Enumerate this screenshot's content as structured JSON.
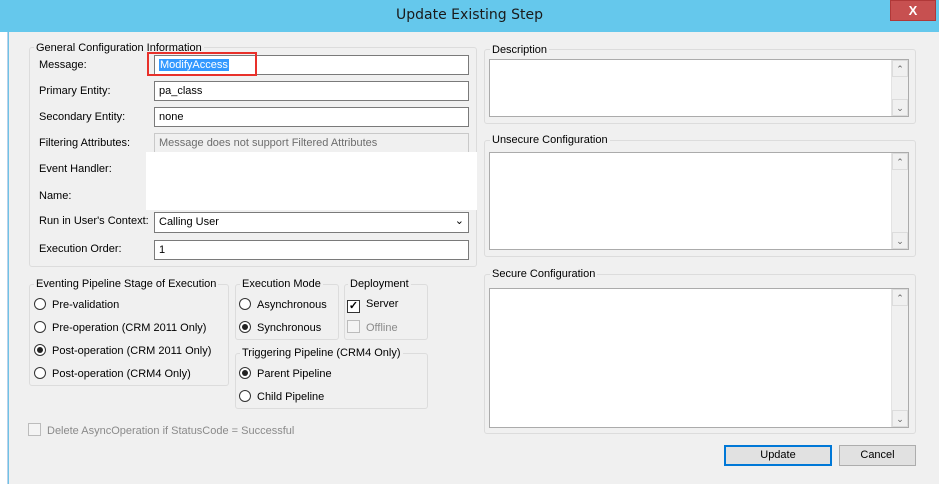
{
  "window": {
    "title": "Update Existing Step",
    "close_label": "X"
  },
  "general": {
    "group_title": "General Configuration Information",
    "message_label": "Message:",
    "message_value": "ModifyAccess",
    "primary_entity_label": "Primary Entity:",
    "primary_entity_value": "pa_class",
    "secondary_entity_label": "Secondary Entity:",
    "secondary_entity_value": "none",
    "filtering_label": "Filtering Attributes:",
    "filtering_value": "Message does not support Filtered Attributes",
    "event_handler_label": "Event Handler:",
    "name_label": "Name:",
    "run_context_label": "Run in User's Context:",
    "run_context_value": "Calling User",
    "execution_order_label": "Execution Order:",
    "execution_order_value": "1"
  },
  "pipeline_stage": {
    "group_title": "Eventing Pipeline Stage of Execution",
    "options": [
      "Pre-validation",
      "Pre-operation (CRM 2011 Only)",
      "Post-operation (CRM 2011 Only)",
      "Post-operation (CRM4 Only)"
    ],
    "selected_index": 2
  },
  "execution_mode": {
    "group_title": "Execution Mode",
    "options": [
      "Asynchronous",
      "Synchronous"
    ],
    "selected_index": 1
  },
  "deployment": {
    "group_title": "Deployment",
    "server_label": "Server",
    "server_checked": true,
    "offline_label": "Offline",
    "offline_checked": false
  },
  "triggering_pipeline": {
    "group_title": "Triggering Pipeline (CRM4 Only)",
    "options": [
      "Parent Pipeline",
      "Child Pipeline"
    ],
    "selected_index": 0
  },
  "delete_async": {
    "label": "Delete AsyncOperation if StatusCode = Successful",
    "checked": false
  },
  "description": {
    "group_title": "Description"
  },
  "unsecure_config": {
    "group_title": "Unsecure Configuration"
  },
  "secure_config": {
    "group_title": "Secure Configuration"
  },
  "buttons": {
    "update_label": "Update",
    "cancel_label": "Cancel"
  },
  "colors": {
    "titlebar": "#65c8ec",
    "highlight": "#e8302a",
    "selection": "#3399ff"
  },
  "icons": {
    "dropdown": "chevron-down-icon",
    "scroll_up": "scroll-up-icon",
    "scroll_down": "scroll-down-icon",
    "check": "checkmark-icon"
  }
}
